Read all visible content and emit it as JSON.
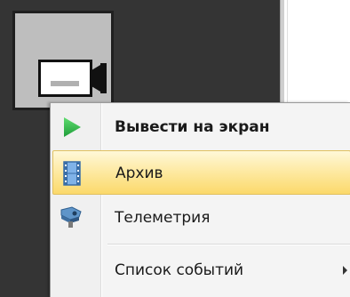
{
  "context_menu": {
    "items": [
      {
        "label": "Вывести на экран",
        "icon": "play-icon",
        "bold": true,
        "highlighted": false,
        "has_submenu": false
      },
      {
        "label": "Архив",
        "icon": "film-icon",
        "bold": false,
        "highlighted": true,
        "has_submenu": false
      },
      {
        "label": "Телеметрия",
        "icon": "telemetry-icon",
        "bold": false,
        "highlighted": false,
        "has_submenu": false
      },
      {
        "label": "Список событий",
        "icon": "",
        "bold": false,
        "highlighted": false,
        "has_submenu": true
      }
    ]
  },
  "camera_tile": {
    "icon": "video-camera-icon"
  },
  "colors": {
    "background_dark": "#343434",
    "tile_bg": "#bebebe",
    "highlight": "#fde79a",
    "play_green": "#2db54b"
  }
}
